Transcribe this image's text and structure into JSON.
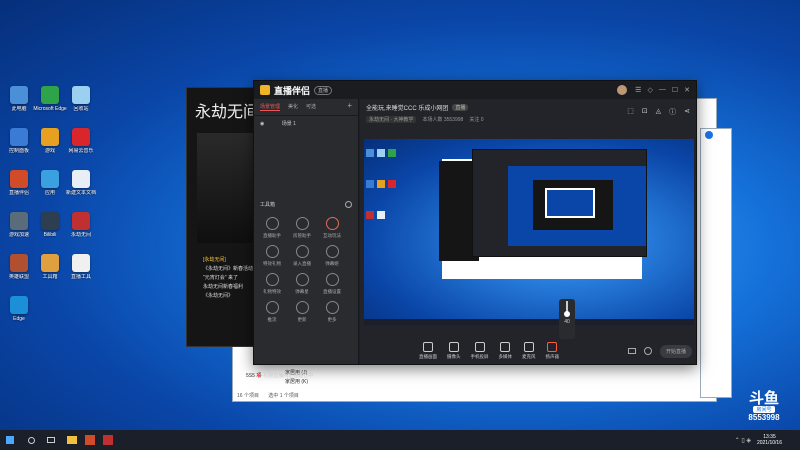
{
  "desktop": {
    "icons": [
      {
        "label": "此电脑",
        "color": "#4a8fd8"
      },
      {
        "label": "Microsoft Edge",
        "color": "#2fa34a"
      },
      {
        "label": "回收站",
        "color": "#9bd0f0"
      },
      {
        "label": "控制面板",
        "color": "#3a7bd5"
      },
      {
        "label": "游戏",
        "color": "#e8a020"
      },
      {
        "label": "网易云音乐",
        "color": "#d9262c"
      },
      {
        "label": "直播伴侣",
        "color": "#d14b28"
      },
      {
        "label": "应用",
        "color": "#3aa0e0"
      },
      {
        "label": "新建文本文档",
        "color": "#e8eef5"
      },
      {
        "label": "游戏加速",
        "color": "#5a6b7a"
      },
      {
        "label": "Bilibili",
        "color": "#2c3e50"
      },
      {
        "label": "永劫无间",
        "color": "#c03030"
      },
      {
        "label": "英雄联盟",
        "color": "#b05030"
      },
      {
        "label": "工具箱",
        "color": "#e0a040"
      },
      {
        "label": "直播工具",
        "color": "#f0f0f0"
      },
      {
        "label": "Edge",
        "color": "#1b8fd8"
      }
    ]
  },
  "app": {
    "title": "直播伴侣",
    "badge": "直播",
    "left_tabs": [
      "场景管理",
      "美化",
      "可选"
    ],
    "scene_label": "场景 1",
    "toolbox_label": "工具箱",
    "tools": [
      "直播助手",
      "房管助手",
      "互动玩法",
      "特效礼物",
      "录入直播",
      "弹幕姬",
      "礼物特效",
      "弹幕星",
      "直播设置",
      "推流",
      "更新",
      "更多"
    ],
    "notice": "礼物直播间正在进行中",
    "room_title": "全能玩,来睡觉CCC 乐成小网团",
    "room_tag": "直播",
    "category": "永劫无间 · 大神教学",
    "stats": [
      "本场人数 3553998",
      "关注 0"
    ],
    "volume_value": "40",
    "controls": [
      "直播画面",
      "摄像头",
      "手机投屏",
      "多媒体",
      "麦克风",
      "扬声器"
    ],
    "start_button": "开始直播"
  },
  "back_window": {
    "game_title": "永劫无间",
    "bullets": [
      "[永劫无间]",
      "《永劫无间》新春活动",
      "\"元宵灯会\" 来了",
      "永劫无间新春福利",
      "《永劫无间》"
    ],
    "list_items": [
      "家居用 (J)",
      "家居用 (K)"
    ],
    "status_count": "16 个项目",
    "status_sel": "选中 1 个项目",
    "footer_left": "5S5 项"
  },
  "watermark": {
    "brand": "斗鱼",
    "sub": "房间号",
    "room": "8553998"
  },
  "taskbar": {
    "time": "13:35",
    "date": "2021/10/16"
  }
}
